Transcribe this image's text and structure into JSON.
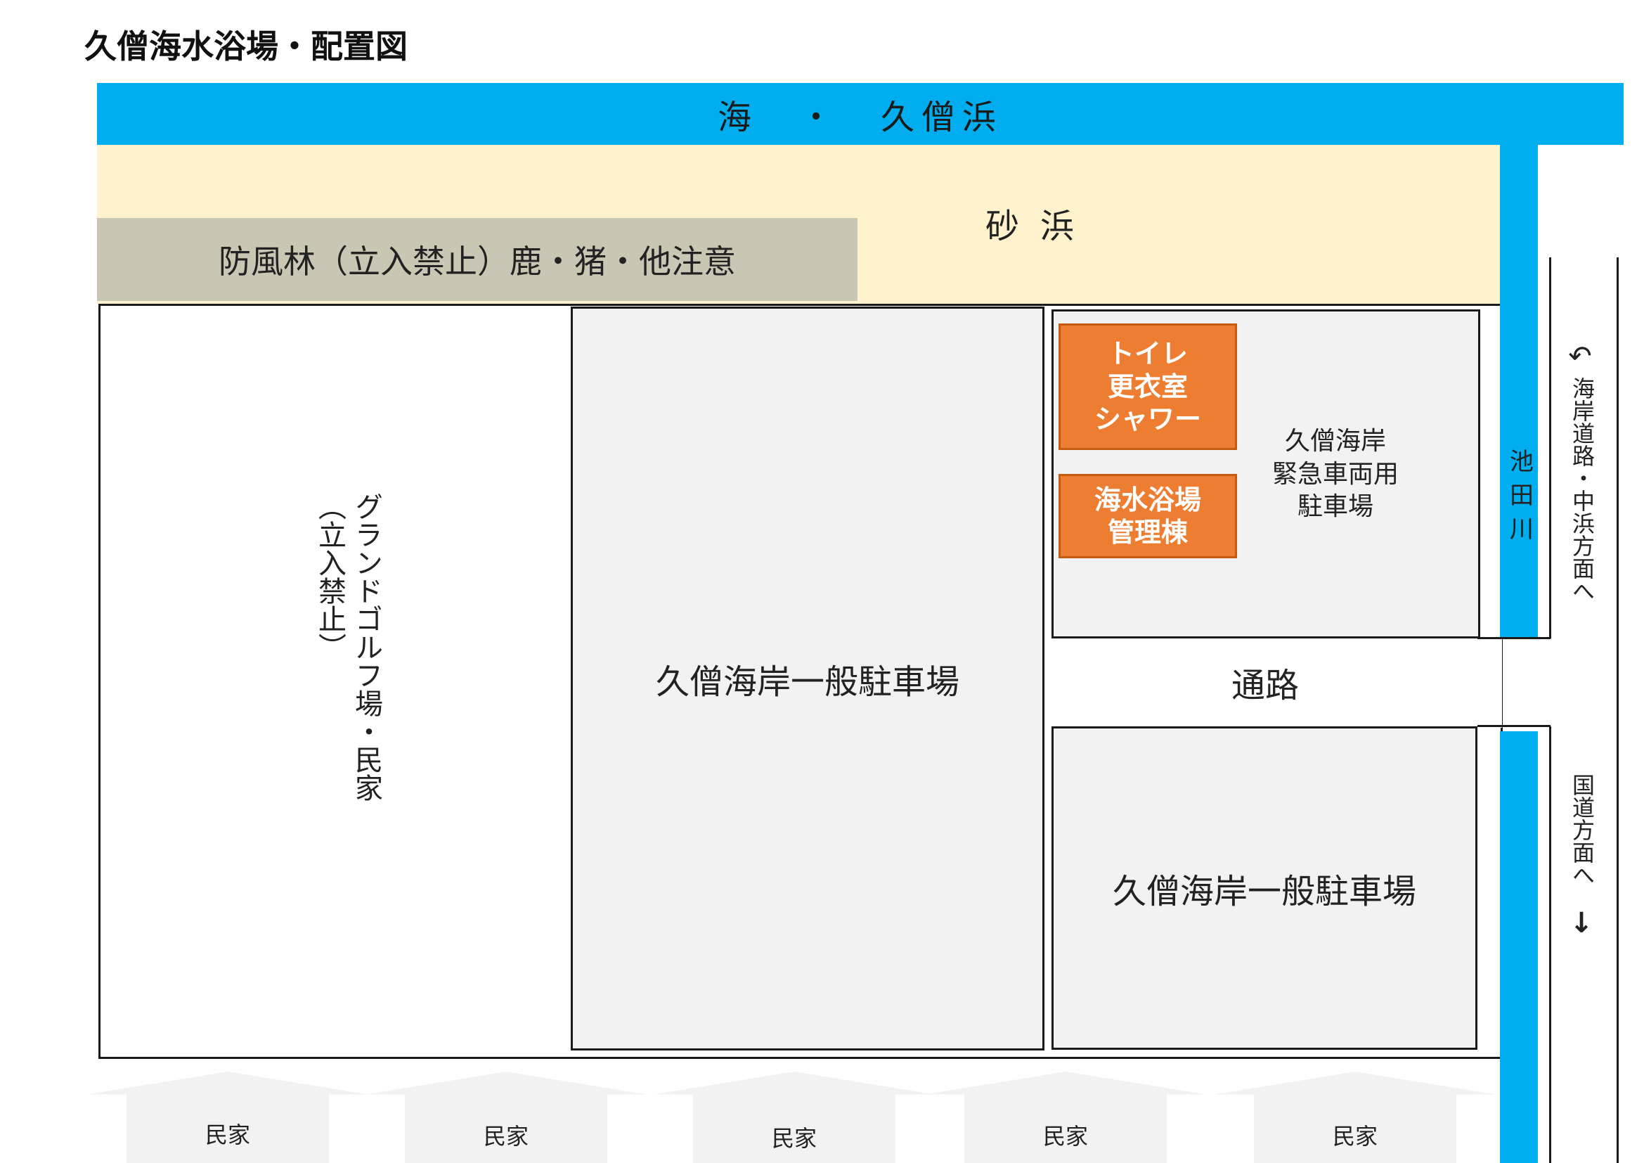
{
  "title": "久僧海水浴場・配置図",
  "sea": {
    "label": "海　・　久僧浜"
  },
  "beach": {
    "label": "砂浜"
  },
  "forest": {
    "label": "防風林（立入禁止）鹿・猪・他注意"
  },
  "golf": {
    "line1": "グランドゴルフ場・民家",
    "line2": "（立入禁止）"
  },
  "lots": {
    "general_center": "久僧海岸一般駐車場",
    "general_right": "久僧海岸一般駐車場",
    "emergency": "久僧海岸\n緊急車両用\n駐車場"
  },
  "facilities": {
    "restroom": "トイレ\n更衣室\nシャワー",
    "management": "海水浴場\n管理棟"
  },
  "road": {
    "label": "通路"
  },
  "river": {
    "label": "池田川"
  },
  "directions": {
    "coast_road": "海岸道路・中浜方面へ",
    "coast_road_arrow": "↶",
    "national_road": "国道方面へ",
    "national_road_arrow": "↓"
  },
  "houses": [
    "民家",
    "民家",
    "民家",
    "民家",
    "民家"
  ],
  "colors": {
    "sea": "#00aeef",
    "sand": "#fff2cc",
    "forest": "#cac6b4",
    "lot": "#f2f2f2",
    "facility": "#ed7d31"
  }
}
